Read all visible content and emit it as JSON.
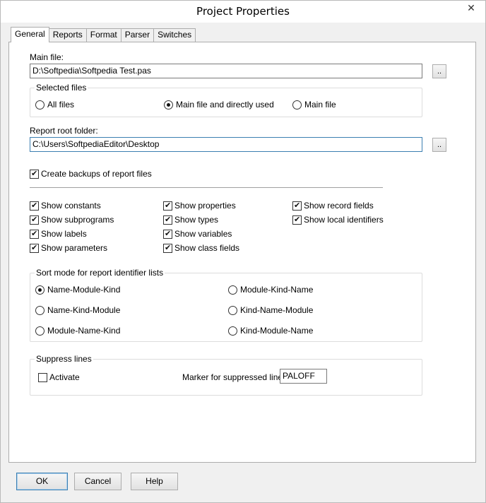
{
  "window": {
    "title": "Project Properties",
    "close_glyph": "✕"
  },
  "tabs": [
    {
      "label": "General",
      "active": true
    },
    {
      "label": "Reports",
      "active": false
    },
    {
      "label": "Format",
      "active": false
    },
    {
      "label": "Parser",
      "active": false
    },
    {
      "label": "Switches",
      "active": false
    }
  ],
  "general": {
    "main_file": {
      "label": "Main file:",
      "value": "D:\\Softpedia\\Softpedia Test.pas",
      "browse_label": ".."
    },
    "selected_files": {
      "title": "Selected files",
      "options": [
        {
          "label": "All files",
          "checked": false
        },
        {
          "label": "Main file and directly used",
          "checked": true
        },
        {
          "label": "Main file",
          "checked": false
        }
      ]
    },
    "report_root": {
      "label": "Report root folder:",
      "value": "C:\\Users\\SoftpediaEditor\\Desktop",
      "browse_label": ".."
    },
    "create_backups": {
      "label": "Create backups of report files",
      "checked": true
    },
    "show_options": [
      {
        "label": "Show constants",
        "checked": true
      },
      {
        "label": "Show subprograms",
        "checked": true
      },
      {
        "label": "Show labels",
        "checked": true
      },
      {
        "label": "Show parameters",
        "checked": true
      },
      {
        "label": "Show properties",
        "checked": true
      },
      {
        "label": "Show types",
        "checked": true
      },
      {
        "label": "Show variables",
        "checked": true
      },
      {
        "label": "Show class fields",
        "checked": true
      },
      {
        "label": "Show record fields",
        "checked": true
      },
      {
        "label": "Show local identifiers",
        "checked": true
      }
    ],
    "sort_mode": {
      "title": "Sort mode for report identifier lists",
      "options": [
        {
          "label": "Name-Module-Kind",
          "checked": true
        },
        {
          "label": "Name-Kind-Module",
          "checked": false
        },
        {
          "label": "Module-Name-Kind",
          "checked": false
        },
        {
          "label": "Module-Kind-Name",
          "checked": false
        },
        {
          "label": "Kind-Name-Module",
          "checked": false
        },
        {
          "label": "Kind-Module-Name",
          "checked": false
        }
      ]
    },
    "suppress": {
      "title": "Suppress lines",
      "activate": {
        "label": "Activate",
        "checked": false
      },
      "marker_label": "Marker for suppressed lines:",
      "marker_value": "PALOFF"
    }
  },
  "buttons": {
    "ok": "OK",
    "cancel": "Cancel",
    "help": "Help"
  }
}
